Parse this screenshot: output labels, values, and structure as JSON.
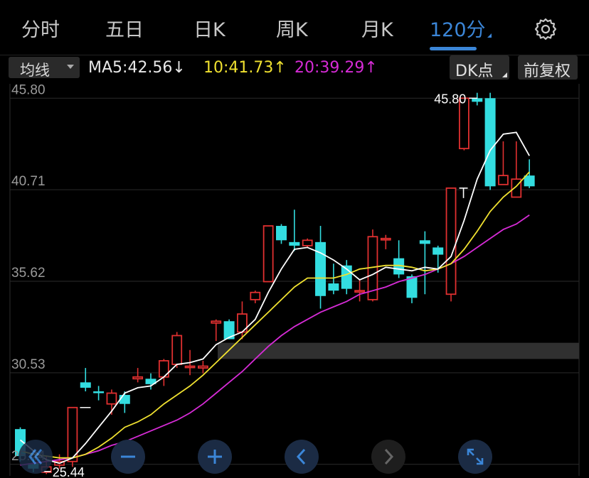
{
  "tabs": [
    {
      "label": "分时"
    },
    {
      "label": "五日"
    },
    {
      "label": "日K"
    },
    {
      "label": "周K"
    },
    {
      "label": "月K"
    },
    {
      "label": "120分",
      "active": true
    }
  ],
  "settings_icon": "gear-icon",
  "ma_bar": {
    "selector_label": "均线",
    "ma5": {
      "label": "MA5:42.56↓",
      "color": "#e8e8e8"
    },
    "ma10": {
      "label": "10:41.73↑",
      "color": "#f0e130"
    },
    "ma20": {
      "label": "20:39.29↑",
      "color": "#d62bd6"
    },
    "dk_label": "DK点",
    "adjust_label": "前复权"
  },
  "colors": {
    "up": "#e03030",
    "down": "#33dde0",
    "ma5": "#ffffff",
    "ma10": "#f0e130",
    "ma20": "#d62bd6",
    "band": "#303030"
  },
  "chart_data": {
    "type": "candlestick",
    "y_ticks": [
      "45.80",
      "40.71",
      "35.62",
      "30.53",
      "25.44"
    ],
    "ylim": [
      24.8,
      46.6
    ],
    "candles": [
      {
        "o": 27.4,
        "c": 25.9,
        "h": 27.5,
        "l": 25.6
      },
      {
        "o": 25.5,
        "c": 25.2,
        "h": 25.8,
        "l": 25.0
      },
      {
        "o": 25.0,
        "c": 25.3,
        "h": 25.9,
        "l": 24.9
      },
      {
        "o": 25.4,
        "c": 25.6,
        "h": 26.0,
        "l": 25.2
      },
      {
        "o": 25.6,
        "c": 28.6,
        "h": 28.6,
        "l": 25.3
      },
      {
        "o": 30.0,
        "c": 29.7,
        "h": 30.8,
        "l": 29.5
      },
      {
        "o": 29.5,
        "c": 29.4,
        "h": 29.8,
        "l": 29.0
      },
      {
        "o": 28.8,
        "c": 29.4,
        "h": 29.6,
        "l": 28.2
      },
      {
        "o": 29.3,
        "c": 28.8,
        "h": 29.5,
        "l": 28.3
      },
      {
        "o": 30.2,
        "c": 30.3,
        "h": 30.8,
        "l": 30.0
      },
      {
        "o": 30.2,
        "c": 29.9,
        "h": 30.5,
        "l": 29.6
      },
      {
        "o": 30.3,
        "c": 31.2,
        "h": 31.3,
        "l": 29.8
      },
      {
        "o": 31.0,
        "c": 32.6,
        "h": 32.8,
        "l": 30.8
      },
      {
        "o": 30.9,
        "c": 30.9,
        "h": 31.8,
        "l": 30.4
      },
      {
        "o": 30.8,
        "c": 30.9,
        "h": 31.2,
        "l": 30.5
      },
      {
        "o": 33.3,
        "c": 33.4,
        "h": 33.5,
        "l": 32.3
      },
      {
        "o": 33.4,
        "c": 32.4,
        "h": 33.5,
        "l": 32.4
      },
      {
        "o": 32.8,
        "c": 33.8,
        "h": 34.5,
        "l": 32.4
      },
      {
        "o": 34.6,
        "c": 35.0,
        "h": 35.1,
        "l": 34.4
      },
      {
        "o": 35.6,
        "c": 38.7,
        "h": 38.7,
        "l": 35.6
      },
      {
        "o": 38.7,
        "c": 37.9,
        "h": 38.8,
        "l": 37.7
      },
      {
        "o": 37.8,
        "c": 37.6,
        "h": 39.6,
        "l": 37.3
      },
      {
        "o": 37.6,
        "c": 37.9,
        "h": 38.0,
        "l": 37.5
      },
      {
        "o": 37.8,
        "c": 34.8,
        "h": 38.7,
        "l": 34.1
      },
      {
        "o": 35.5,
        "c": 35.1,
        "h": 36.6,
        "l": 34.9
      },
      {
        "o": 36.5,
        "c": 35.2,
        "h": 36.8,
        "l": 34.9
      },
      {
        "o": 35.1,
        "c": 35.1,
        "h": 35.7,
        "l": 34.5
      },
      {
        "o": 34.6,
        "c": 38.1,
        "h": 38.5,
        "l": 34.5
      },
      {
        "o": 38.0,
        "c": 38.0,
        "h": 38.2,
        "l": 37.4
      },
      {
        "o": 36.9,
        "c": 36.0,
        "h": 37.9,
        "l": 35.8
      },
      {
        "o": 35.9,
        "c": 34.7,
        "h": 36.0,
        "l": 34.4
      },
      {
        "o": 37.9,
        "c": 37.7,
        "h": 38.4,
        "l": 34.9
      },
      {
        "o": 37.5,
        "c": 37.1,
        "h": 37.6,
        "l": 36.1
      },
      {
        "o": 34.9,
        "c": 40.8,
        "h": 40.8,
        "l": 34.5
      },
      {
        "o": 43.0,
        "c": 45.8,
        "h": 45.8,
        "l": 42.9
      },
      {
        "o": 45.8,
        "c": 45.6,
        "h": 46.1,
        "l": 45.4
      },
      {
        "o": 45.8,
        "c": 40.9,
        "h": 46.1,
        "l": 40.7
      },
      {
        "o": 41.0,
        "c": 41.5,
        "h": 43.4,
        "l": 41.0
      },
      {
        "o": 40.3,
        "c": 41.3,
        "h": 43.4,
        "l": 40.3
      },
      {
        "o": 41.5,
        "c": 40.9,
        "h": 42.4,
        "l": 40.8
      }
    ],
    "ma5": [
      26.8,
      26.2,
      25.7,
      25.5,
      25.8,
      26.6,
      27.5,
      28.4,
      29.4,
      29.7,
      29.8,
      30.3,
      31.0,
      31.1,
      31.3,
      32.1,
      32.5,
      32.8,
      33.5,
      35.0,
      36.3,
      37.4,
      37.5,
      37.2,
      36.8,
      36.3,
      35.7,
      36.0,
      36.4,
      36.3,
      36.2,
      36.4,
      36.3,
      37.0,
      39.0,
      41.3,
      42.9,
      43.8,
      43.9,
      42.6
    ],
    "ma10": [
      26.2,
      26.0,
      25.9,
      25.8,
      25.8,
      26.0,
      26.4,
      26.9,
      27.5,
      27.8,
      28.2,
      28.8,
      29.3,
      29.8,
      30.4,
      31.1,
      31.8,
      32.5,
      33.2,
      33.9,
      34.6,
      35.3,
      35.8,
      35.8,
      35.8,
      36.0,
      36.3,
      36.4,
      36.5,
      36.5,
      36.4,
      36.2,
      36.3,
      36.6,
      37.4,
      38.4,
      39.5,
      40.3,
      40.9,
      41.7
    ],
    "ma20": [
      25.4,
      25.5,
      25.6,
      25.7,
      25.8,
      26.0,
      26.2,
      26.5,
      26.7,
      27.0,
      27.3,
      27.6,
      27.9,
      28.3,
      28.8,
      29.4,
      30.0,
      30.6,
      31.3,
      32.0,
      32.6,
      33.1,
      33.5,
      33.9,
      34.2,
      34.5,
      34.9,
      35.1,
      35.3,
      35.6,
      35.8,
      36.0,
      36.3,
      36.6,
      37.0,
      37.5,
      38.0,
      38.5,
      38.8,
      39.3
    ],
    "band": [
      31.3,
      32.2
    ],
    "annotations": [
      {
        "text": "45.80",
        "index": 35
      },
      {
        "text": "25.44",
        "index": 2
      }
    ]
  },
  "controls": [
    {
      "icon": "double-chevron-left-icon"
    },
    {
      "icon": "zoom-out-icon"
    },
    {
      "icon": "zoom-in-icon"
    },
    {
      "icon": "chevron-left-icon"
    },
    {
      "icon": "chevron-right-icon"
    },
    {
      "icon": "fullscreen-icon"
    }
  ]
}
